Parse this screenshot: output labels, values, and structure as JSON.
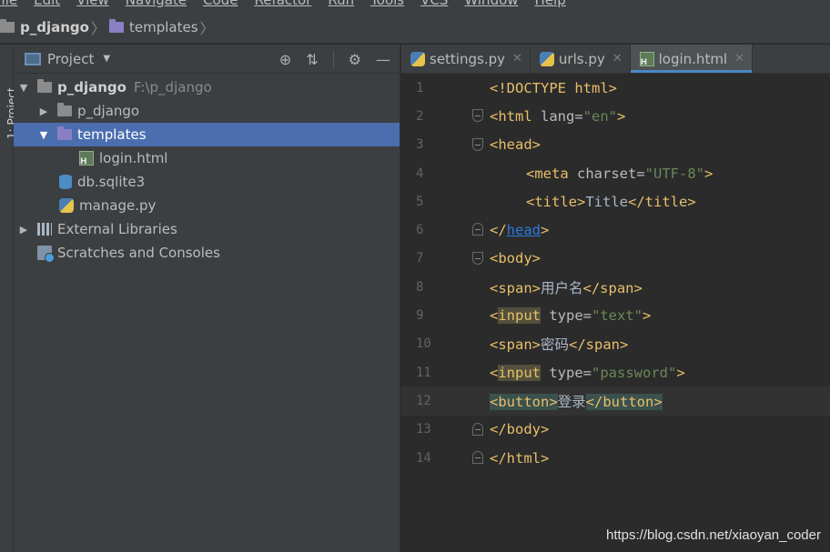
{
  "menu": [
    "File",
    "Edit",
    "View",
    "Navigate",
    "Code",
    "Refactor",
    "Run",
    "Tools",
    "VCS",
    "Window",
    "Help"
  ],
  "breadcrumb": {
    "project": "p_django",
    "folder": "templates"
  },
  "toolstrip": {
    "label": "1: Project"
  },
  "project_panel": {
    "title": "Project",
    "tree": [
      {
        "label": "p_django",
        "hint": "F:\\p_django"
      },
      {
        "label": "p_django"
      },
      {
        "label": "templates"
      },
      {
        "label": "login.html"
      },
      {
        "label": "db.sqlite3"
      },
      {
        "label": "manage.py"
      },
      {
        "label": "External Libraries"
      },
      {
        "label": "Scratches and Consoles"
      }
    ]
  },
  "tabs": [
    {
      "label": "settings.py"
    },
    {
      "label": "urls.py"
    },
    {
      "label": "login.html"
    }
  ],
  "code": {
    "line_numbers": [
      "1",
      "2",
      "3",
      "4",
      "5",
      "6",
      "7",
      "8",
      "9",
      "10",
      "11",
      "12",
      "13",
      "14"
    ],
    "l1": "<!DOCTYPE html>",
    "l2_tag": "<html ",
    "l2_attr": "lang=",
    "l2_val": "\"en\"",
    "l2_end": ">",
    "l3": "<head>",
    "l4_tag": "<meta ",
    "l4_attr": "charset=",
    "l4_val": "\"UTF-8\"",
    "l4_end": ">",
    "l5_open": "<title>",
    "l5_text": "Title",
    "l5_close": "</title>",
    "l6_a": "</",
    "l6_b": "head",
    "l6_c": ">",
    "l7": "<body>",
    "l8_open": "<span>",
    "l8_text": "用户名",
    "l8_close": "</span>",
    "l9_a": "<",
    "l9_b": "input",
    "l9_attr": " type=",
    "l9_val": "\"text\"",
    "l9_end": ">",
    "l10_open": "<span>",
    "l10_text": "密码",
    "l10_close": "</span>",
    "l11_a": "<",
    "l11_b": "input",
    "l11_attr": " type=",
    "l11_val": "\"password\"",
    "l11_end": ">",
    "l12_open": "<button>",
    "l12_text": "登录",
    "l12_close": "</button>",
    "l13": "</body>",
    "l14": "</html>"
  },
  "watermark": "https://blog.csdn.net/xiaoyan_coder"
}
